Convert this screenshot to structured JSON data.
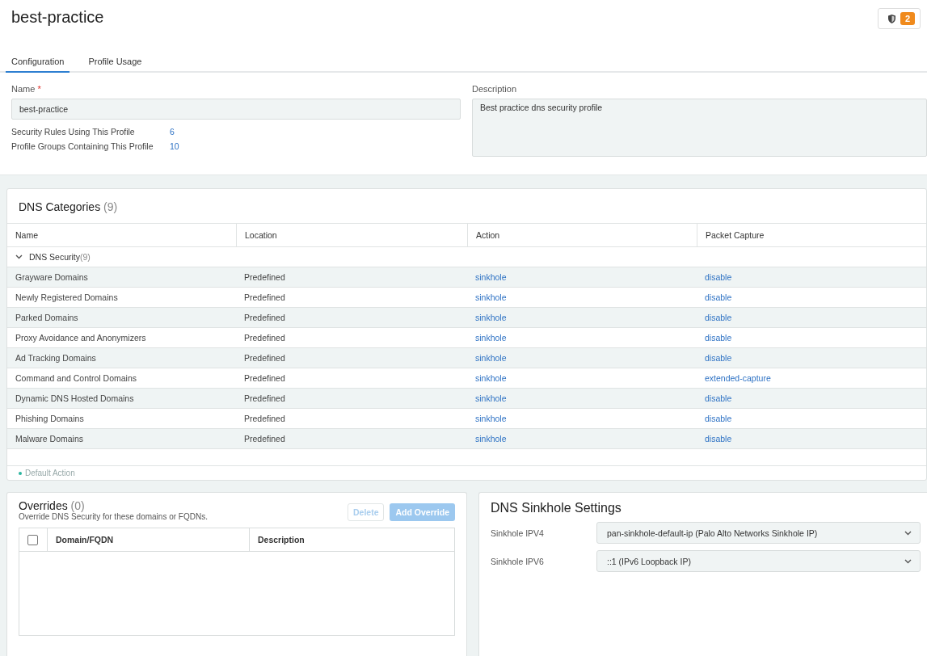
{
  "page": {
    "title": "best-practice",
    "alert_count": "2"
  },
  "tabs": [
    {
      "label": "Configuration",
      "selected": true
    },
    {
      "label": "Profile Usage",
      "selected": false
    }
  ],
  "form": {
    "name_label": "Name",
    "name_required_mark": "*",
    "name_value": "best-practice",
    "description_label": "Description",
    "description_value": "Best practice dns security profile",
    "stats": [
      {
        "label": "Security Rules Using This Profile",
        "value": "6"
      },
      {
        "label": "Profile Groups Containing This Profile",
        "value": "10"
      }
    ]
  },
  "dns_categories": {
    "title": "DNS Categories",
    "count": "(9)",
    "columns": [
      "Name",
      "Location",
      "Action",
      "Packet Capture"
    ],
    "group": {
      "label": "DNS Security",
      "count": "(9)",
      "expanded": true
    },
    "rows": [
      {
        "name": "Grayware Domains",
        "location": "Predefined",
        "action": "sinkhole",
        "packet_capture": "disable"
      },
      {
        "name": "Newly Registered Domains",
        "location": "Predefined",
        "action": "sinkhole",
        "packet_capture": "disable"
      },
      {
        "name": "Parked Domains",
        "location": "Predefined",
        "action": "sinkhole",
        "packet_capture": "disable"
      },
      {
        "name": "Proxy Avoidance and Anonymizers",
        "location": "Predefined",
        "action": "sinkhole",
        "packet_capture": "disable"
      },
      {
        "name": "Ad Tracking Domains",
        "location": "Predefined",
        "action": "sinkhole",
        "packet_capture": "disable"
      },
      {
        "name": "Command and Control Domains",
        "location": "Predefined",
        "action": "sinkhole",
        "packet_capture": "extended-capture"
      },
      {
        "name": "Dynamic DNS Hosted Domains",
        "location": "Predefined",
        "action": "sinkhole",
        "packet_capture": "disable"
      },
      {
        "name": "Phishing Domains",
        "location": "Predefined",
        "action": "sinkhole",
        "packet_capture": "disable"
      },
      {
        "name": "Malware Domains",
        "location": "Predefined",
        "action": "sinkhole",
        "packet_capture": "disable"
      }
    ],
    "legend": {
      "label": "Default Action",
      "color": "#2bb5a0"
    }
  },
  "overrides": {
    "title": "Overrides",
    "count": "(0)",
    "subtitle": "Override DNS Security for these domains or FQDNs.",
    "buttons": [
      {
        "label": "Delete",
        "kind": "secondary",
        "disabled": true
      },
      {
        "label": "Add Override",
        "kind": "primary",
        "disabled": true
      }
    ],
    "select_all_checked": false,
    "columns": [
      "Domain/FQDN",
      "Description"
    ]
  },
  "sinkhole": {
    "title": "DNS Sinkhole Settings",
    "fields": [
      {
        "label": "Sinkhole IPV4",
        "value": "pan-sinkhole-default-ip (Palo Alto Networks Sinkhole IP)"
      },
      {
        "label": "Sinkhole IPV6",
        "value": "::1 (IPv6 Loopback IP)"
      }
    ]
  }
}
